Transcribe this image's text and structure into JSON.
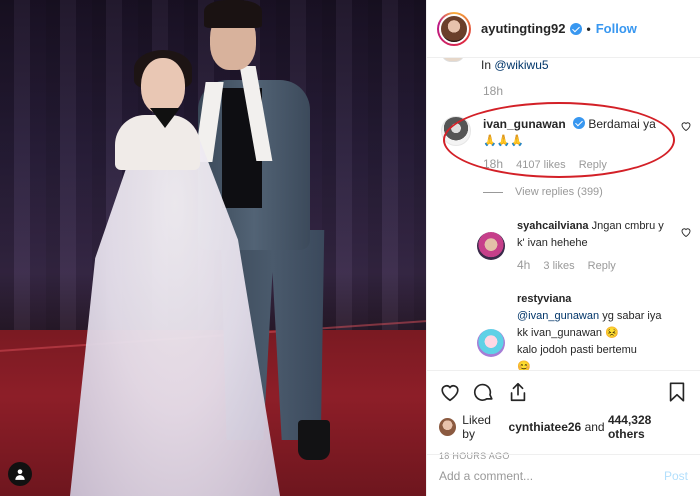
{
  "post": {
    "username": "ayutingting92",
    "follow_label": "Follow",
    "dot": "•"
  },
  "comments": {
    "partial": {
      "prefix": "In",
      "mention": "@wikiwu5",
      "time": "18h"
    },
    "main": {
      "username": "ivan_gunawan",
      "text": "Berdamai ya",
      "emoji": "🙏🙏🙏",
      "time": "18h",
      "likes": "4107 likes",
      "reply_label": "Reply"
    },
    "view_replies": "View replies (399)",
    "replies": [
      {
        "username": "syahcailviana",
        "text": "Jngan cmbru y k' ivan hehehe",
        "time": "4h",
        "likes": "3 likes",
        "reply_label": "Reply"
      },
      {
        "username": "restyviana",
        "mention": "@ivan_gunawan",
        "text": "yg sabar iya kk ivan_gunawan",
        "emoji1": "😣",
        "text2": "kalo jodoh pasti bertemu",
        "emoji2": "😊"
      }
    ]
  },
  "likes_line": {
    "prefix": "Liked by",
    "user": "cynthiatee26",
    "middle": "and",
    "count": "444,328 others"
  },
  "timestamp": "18 HOURS AGO",
  "add_comment": {
    "placeholder": "Add a comment...",
    "post_label": "Post"
  },
  "colors": {
    "link": "#3897f0",
    "highlight_oval": "#d32027",
    "muted": "#999999"
  }
}
